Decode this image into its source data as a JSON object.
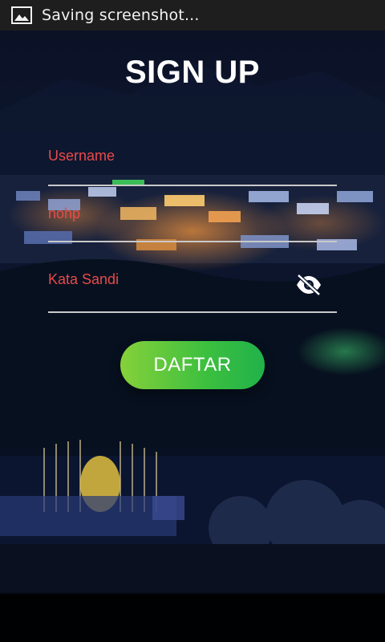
{
  "status_bar": {
    "notification_icon": "image-icon",
    "text": "Saving screenshot..."
  },
  "form": {
    "title": "SIGN UP",
    "username_label": "Username",
    "nohp_label": "nohp",
    "password_label": "Kata Sandi",
    "password_toggle_icon": "eye-off-icon",
    "submit_label": "DAFTAR"
  },
  "colors": {
    "label": "#e84a4a",
    "underline": "#c9c9c9",
    "button_start": "#86d13a",
    "button_end": "#21b24a",
    "status_bar": "#1e1e1e"
  }
}
